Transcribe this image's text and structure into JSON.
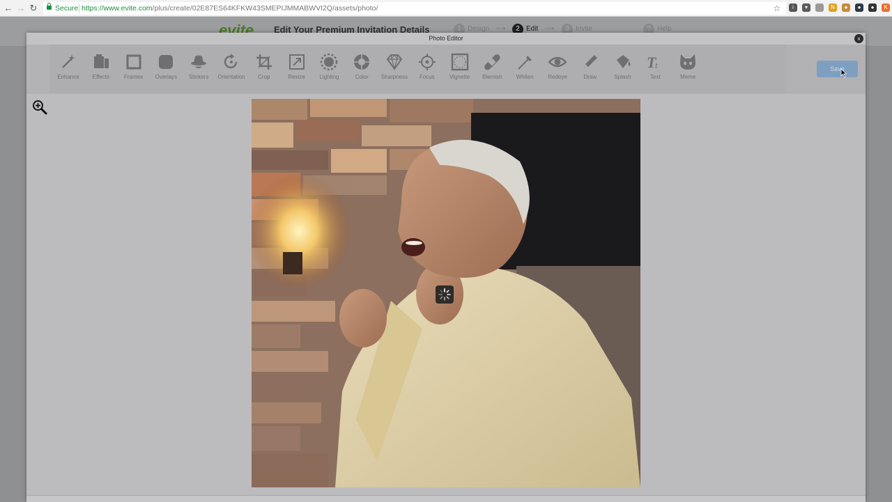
{
  "browser": {
    "secure_label": "Secure",
    "url_host": "https://www.evite.com",
    "url_path": "/plus/create/02E87ES64KFKW43SMEPIJMMABWVI2Q/assets/photo/",
    "extensions": [
      {
        "name": "info-icon",
        "color": "#555555",
        "glyph": "i"
      },
      {
        "name": "pocket-icon",
        "color": "#5a5a5a",
        "glyph": "▾"
      },
      {
        "name": "extension-icon",
        "color": "#9a9a9a",
        "glyph": ""
      },
      {
        "name": "new-badge-icon",
        "color": "#e0a020",
        "glyph": "N"
      },
      {
        "name": "cookie-icon",
        "color": "#c88a3a",
        "glyph": "●"
      },
      {
        "name": "dark-circle-icon",
        "color": "#2a3a4a",
        "glyph": "●"
      },
      {
        "name": "menu-dot-icon",
        "color": "#333333",
        "glyph": "●"
      },
      {
        "name": "k-extension-icon",
        "color": "#e8702a",
        "glyph": "K"
      }
    ]
  },
  "evite": {
    "logo": "evite",
    "title": "Edit Your Premium Invitation Details",
    "steps": [
      {
        "num": "1",
        "label": "Design"
      },
      {
        "num": "2",
        "label": "Edit"
      },
      {
        "num": "3",
        "label": "Invite"
      },
      {
        "num": "?",
        "label": "Help"
      }
    ]
  },
  "editor": {
    "title": "Photo Editor",
    "close": "x",
    "save_label": "Save",
    "tools": [
      {
        "label": "Enhance",
        "icon": "magic-wand"
      },
      {
        "label": "Effects",
        "icon": "film"
      },
      {
        "label": "Frames",
        "icon": "frame"
      },
      {
        "label": "Overlays",
        "icon": "overlay"
      },
      {
        "label": "Stickers",
        "icon": "hat"
      },
      {
        "label": "Orientation",
        "icon": "rotate"
      },
      {
        "label": "Crop",
        "icon": "crop"
      },
      {
        "label": "Resize",
        "icon": "resize"
      },
      {
        "label": "Lighting",
        "icon": "sun"
      },
      {
        "label": "Color",
        "icon": "palette"
      },
      {
        "label": "Sharpness",
        "icon": "diamond"
      },
      {
        "label": "Focus",
        "icon": "target"
      },
      {
        "label": "Vignette",
        "icon": "vignette"
      },
      {
        "label": "Blemish",
        "icon": "bandage"
      },
      {
        "label": "Whiten",
        "icon": "brush"
      },
      {
        "label": "Redeye",
        "icon": "eye"
      },
      {
        "label": "Draw",
        "icon": "pencil"
      },
      {
        "label": "Splash",
        "icon": "bucket"
      },
      {
        "label": "Text",
        "icon": "text"
      },
      {
        "label": "Meme",
        "icon": "cat"
      }
    ]
  },
  "colors": {
    "accent": "#7e9fc0",
    "secure": "#1e8e3e"
  }
}
